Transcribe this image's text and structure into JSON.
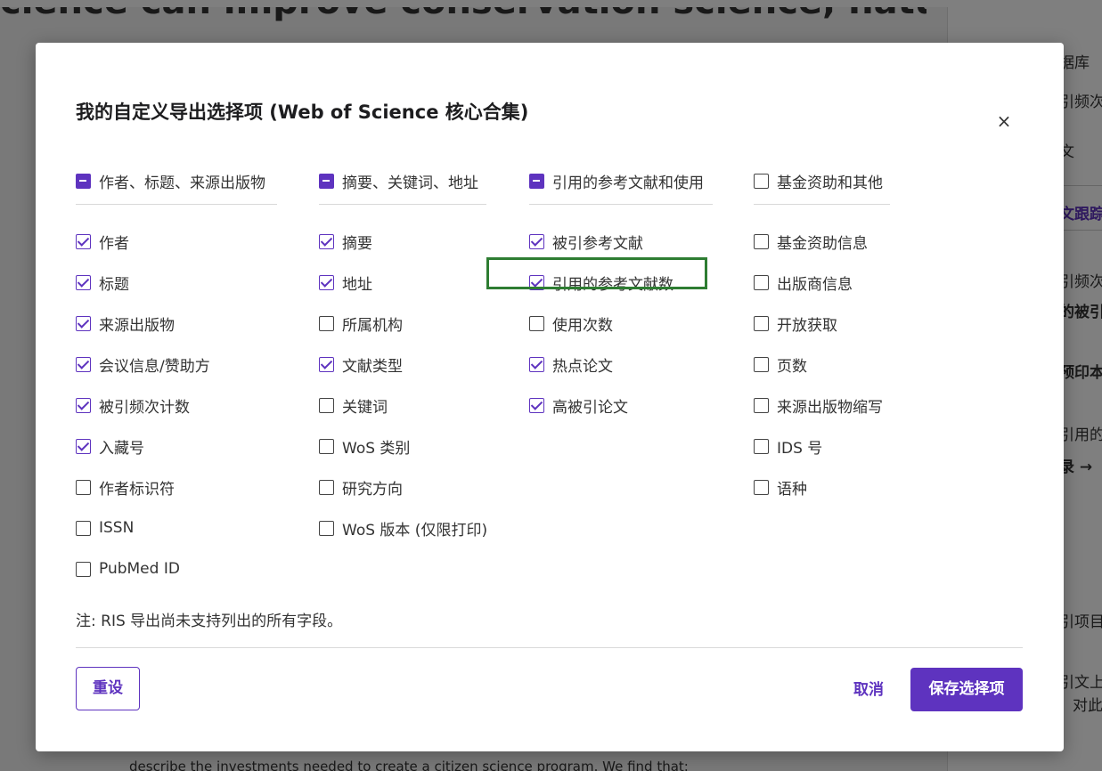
{
  "background": {
    "heading": "cience can improve conservation science, natural resource",
    "bottom_text": "describe the investments needed to create a citizen science program. We find that:",
    "sidebar": [
      "据库",
      "引频次",
      "文",
      "文跟踪",
      "引频次",
      "的被引",
      "预印本",
      "引用的",
      "录 →",
      "引项目",
      "引文上",
      "对此"
    ]
  },
  "modal": {
    "title": "我的自定义导出选择项 (Web of Science 核心合集)",
    "close_label": "×",
    "columns": [
      {
        "header": "作者、标题、来源出版物",
        "header_state": "partial",
        "items": [
          {
            "label": "作者",
            "checked": true
          },
          {
            "label": "标题",
            "checked": true
          },
          {
            "label": "来源出版物",
            "checked": true
          },
          {
            "label": "会议信息/赞助方",
            "checked": true
          },
          {
            "label": "被引频次计数",
            "checked": true
          },
          {
            "label": "入藏号",
            "checked": true
          },
          {
            "label": "作者标识符",
            "checked": false
          },
          {
            "label": "ISSN",
            "checked": false
          },
          {
            "label": "PubMed ID",
            "checked": false
          }
        ]
      },
      {
        "header": "摘要、关键词、地址",
        "header_state": "partial",
        "items": [
          {
            "label": "摘要",
            "checked": true
          },
          {
            "label": "地址",
            "checked": true
          },
          {
            "label": "所属机构",
            "checked": false
          },
          {
            "label": "文献类型",
            "checked": true
          },
          {
            "label": "关键词",
            "checked": false
          },
          {
            "label": "WoS 类别",
            "checked": false
          },
          {
            "label": "研究方向",
            "checked": false
          },
          {
            "label": "WoS 版本 (仅限打印)",
            "checked": false
          }
        ]
      },
      {
        "header": "引用的参考文献和使用",
        "header_state": "partial",
        "items": [
          {
            "label": "被引参考文献",
            "checked": true
          },
          {
            "label": "引用的参考文献数",
            "checked": true
          },
          {
            "label": "使用次数",
            "checked": false
          },
          {
            "label": "热点论文",
            "checked": true
          },
          {
            "label": "高被引论文",
            "checked": true
          }
        ]
      },
      {
        "header": "基金资助和其他",
        "header_state": "unchecked",
        "items": [
          {
            "label": "基金资助信息",
            "checked": false
          },
          {
            "label": "出版商信息",
            "checked": false
          },
          {
            "label": "开放获取",
            "checked": false
          },
          {
            "label": "页数",
            "checked": false
          },
          {
            "label": "来源出版物缩写",
            "checked": false
          },
          {
            "label": "IDS 号",
            "checked": false
          },
          {
            "label": "语种",
            "checked": false
          }
        ]
      }
    ],
    "note": "注: RIS 导出尚未支持列出的所有字段。",
    "reset_label": "重设",
    "cancel_label": "取消",
    "save_label": "保存选择项"
  },
  "colors": {
    "accent": "#5e33bf",
    "highlight": "#2e7d32"
  }
}
